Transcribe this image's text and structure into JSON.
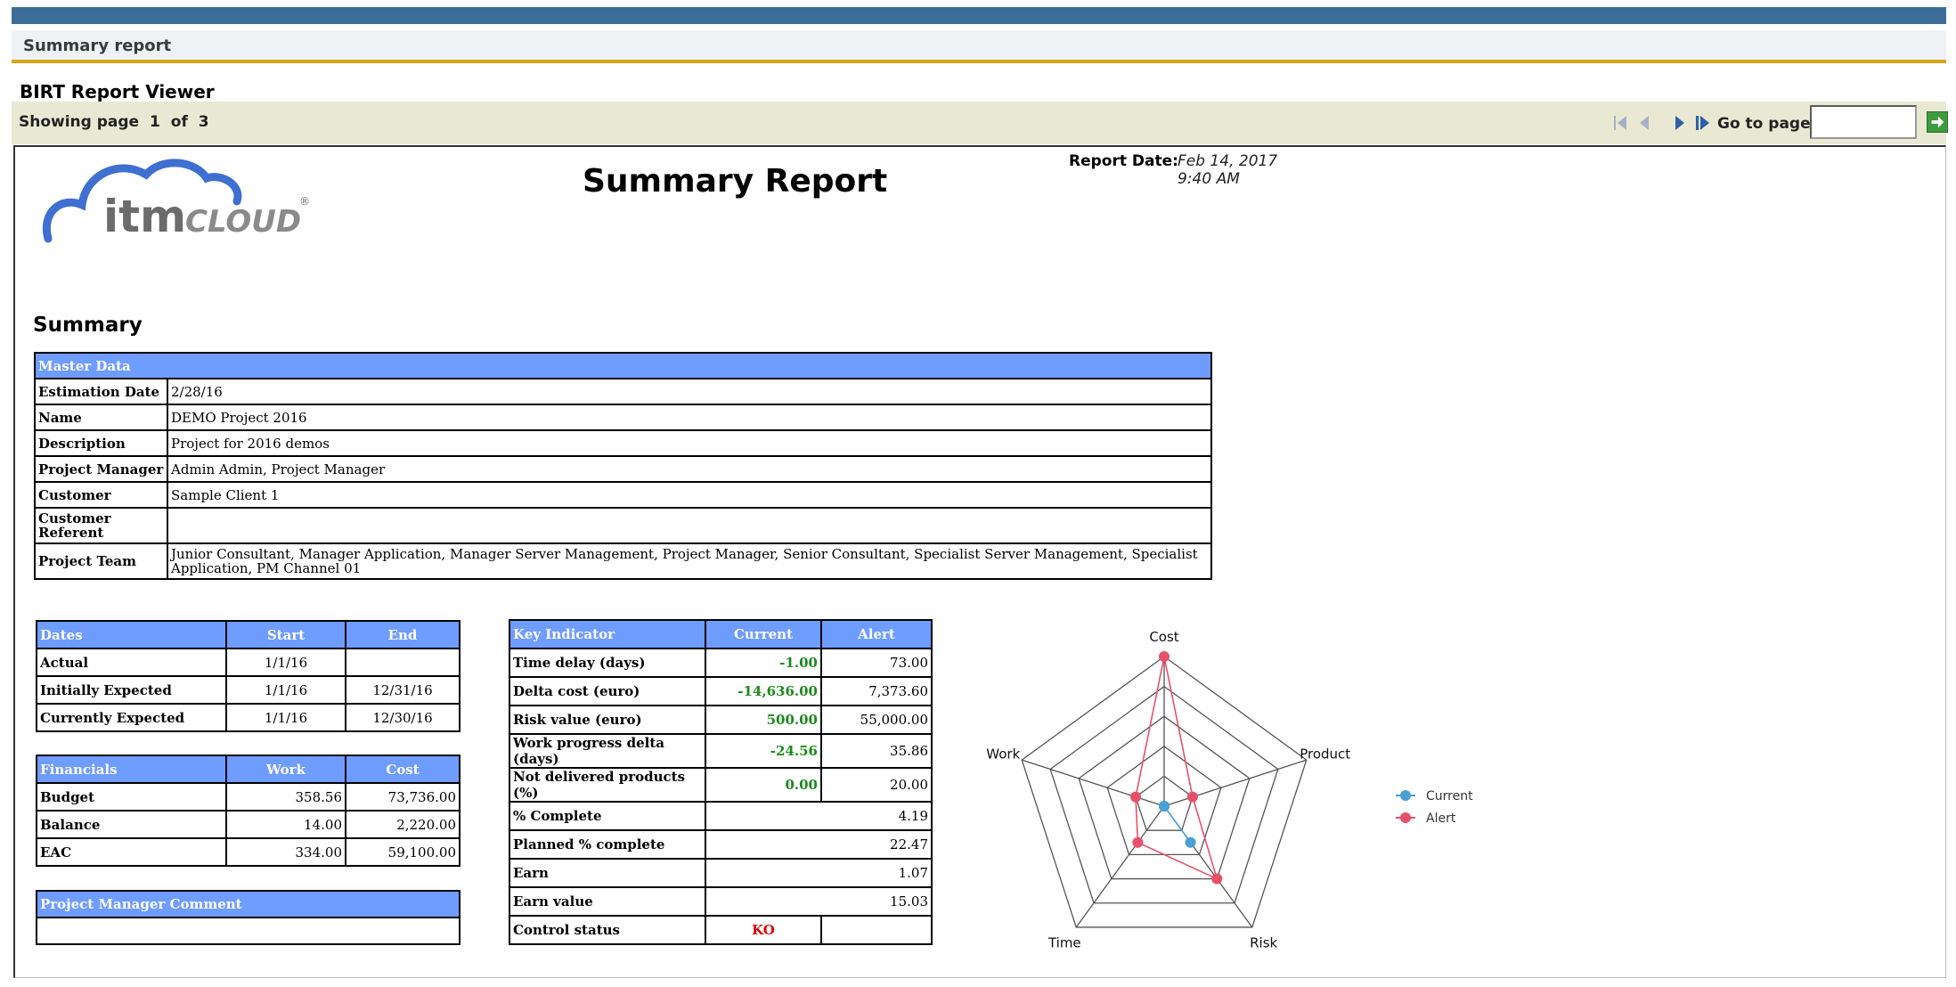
{
  "header": {
    "section_title": "Summary report"
  },
  "viewer": {
    "title": "BIRT Report Viewer",
    "paging": {
      "prefix": "Showing page",
      "current": "1",
      "of_label": "of",
      "total": "3"
    },
    "goto_label": "Go to page:",
    "goto_value": ""
  },
  "report": {
    "title": "Summary Report",
    "date_label": "Report Date:",
    "date_value": "Feb 14, 2017 9:40 AM",
    "logo": {
      "text_main": "itm",
      "text_secondary": "CLOUD",
      "registered": "®"
    },
    "summary_heading": "Summary",
    "master": {
      "header": "Master Data",
      "rows": [
        {
          "label": "Estimation Date",
          "value": "2/28/16"
        },
        {
          "label": "Name",
          "value": "DEMO Project 2016"
        },
        {
          "label": "Description",
          "value": "Project for 2016 demos"
        },
        {
          "label": "Project Manager",
          "value": "Admin Admin, Project Manager"
        },
        {
          "label": "Customer",
          "value": "Sample Client 1"
        },
        {
          "label": "Customer Referent",
          "value": ""
        },
        {
          "label": "Project Team",
          "value": "Junior Consultant, Manager Application, Manager Server Management, Project Manager, Senior Consultant, Specialist Server Management, Specialist Application, PM Channel 01"
        }
      ]
    },
    "dates": {
      "headers": [
        "Dates",
        "Start",
        "End"
      ],
      "rows": [
        {
          "label": "Actual",
          "start": "1/1/16",
          "end": ""
        },
        {
          "label": "Initially Expected",
          "start": "1/1/16",
          "end": "12/31/16"
        },
        {
          "label": "Currently Expected",
          "start": "1/1/16",
          "end": "12/30/16"
        }
      ]
    },
    "financials": {
      "headers": [
        "Financials",
        "Work",
        "Cost"
      ],
      "rows": [
        {
          "label": "Budget",
          "work": "358.56",
          "cost": "73,736.00"
        },
        {
          "label": "Balance",
          "work": "14.00",
          "cost": "2,220.00"
        },
        {
          "label": "EAC",
          "work": "334.00",
          "cost": "59,100.00"
        }
      ]
    },
    "pm_comment": {
      "header": "Project Manager Comment",
      "text": ""
    },
    "kpi": {
      "headers": [
        "Key Indicator",
        "Current",
        "Alert"
      ],
      "rows": [
        {
          "label": "Time delay (days)",
          "current": "-1.00",
          "alert": "73.00"
        },
        {
          "label": "Delta cost (euro)",
          "current": "-14,636.00",
          "alert": "7,373.60"
        },
        {
          "label": "Risk value  (euro)",
          "current": "500.00",
          "alert": "55,000.00"
        },
        {
          "label": "Work progress delta (days)",
          "current": "-24.56",
          "alert": "35.86"
        },
        {
          "label": "Not delivered products (%)",
          "current": "0.00",
          "alert": "20.00"
        }
      ],
      "single_rows": [
        {
          "label": "% Complete",
          "value": "4.19"
        },
        {
          "label": "Planned % complete",
          "value": "22.47"
        },
        {
          "label": "Earn",
          "value": "1.07"
        },
        {
          "label": "Earn value",
          "value": "15.03"
        }
      ],
      "control_status": {
        "label": "Control status",
        "value": "KO"
      }
    }
  },
  "chart_data": {
    "type": "radar",
    "axes": [
      "Cost",
      "Product",
      "Risk",
      "Time",
      "Work"
    ],
    "rmax": 5,
    "rings": 5,
    "series": [
      {
        "name": "Current",
        "color": "#4a9fd5",
        "values": [
          0,
          0,
          1.5,
          0,
          0
        ]
      },
      {
        "name": "Alert",
        "color": "#e8506a",
        "values": [
          5,
          1.0,
          3.0,
          1.5,
          1.0
        ]
      }
    ],
    "legend_position": "right"
  },
  "colors": {
    "topbar": "#3d6e99",
    "accent_rule": "#d8a417",
    "table_header": "#6f9cff",
    "good_value": "#1c8a1c",
    "bad_value": "#e00000"
  },
  "icons": [
    "first-page-icon",
    "previous-page-icon",
    "next-page-icon",
    "last-page-icon",
    "go-arrow-icon"
  ]
}
